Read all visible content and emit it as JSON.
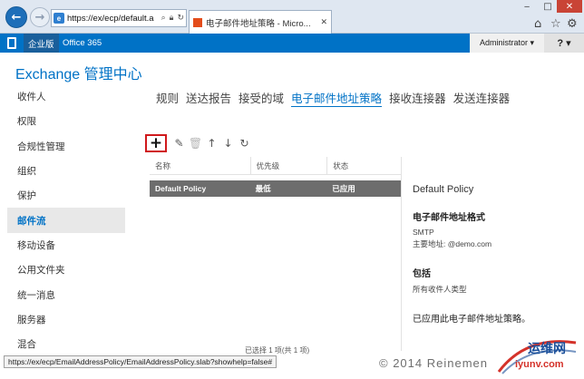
{
  "browser": {
    "address": "https://ex/ecp/default.a",
    "tab_title": "电子邮件地址策略 - Micro...",
    "tab_close": "✕",
    "window_controls": {
      "minimize": "‒",
      "maximize": "□",
      "close": "✕"
    },
    "toolbar_icons": [
      "home-icon",
      "star-icon",
      "gear-icon"
    ]
  },
  "suite_bar": {
    "enterprise": "企业版",
    "office365": "Office 365",
    "admin": "Administrator ▾",
    "help": "? ▾",
    "brand_color": "#0072c6"
  },
  "app": {
    "title": "Exchange 管理中心"
  },
  "left_nav": {
    "items": [
      {
        "label": "收件人"
      },
      {
        "label": "权限"
      },
      {
        "label": "合规性管理"
      },
      {
        "label": "组织"
      },
      {
        "label": "保护"
      },
      {
        "label": "邮件流"
      },
      {
        "label": "移动设备"
      },
      {
        "label": "公用文件夹"
      },
      {
        "label": "统一消息"
      },
      {
        "label": "服务器"
      },
      {
        "label": "混合"
      }
    ],
    "active_index": 5
  },
  "tabs": {
    "items": [
      "规则",
      "送达报告",
      "接受的域",
      "电子邮件地址策略",
      "接收连接器",
      "发送连接器"
    ],
    "active_index": 3
  },
  "list": {
    "columns": [
      "名称",
      "优先级",
      "状态"
    ],
    "rows": [
      {
        "name": "Default Policy",
        "priority": "最低",
        "status": "已应用"
      }
    ],
    "footer": "已选择 1 项(共 1 项)"
  },
  "details": {
    "title": "Default Policy",
    "format_heading": "电子邮件地址格式",
    "format_type": "SMTP",
    "primary_address": "主要地址: @demo.com",
    "includes_heading": "包括",
    "includes_value": "所有收件人类型",
    "applied_status": "已应用此电子邮件地址策略。"
  },
  "status_url": "https://ex/ecp/EmailAddressPolicy/EmailAddressPolicy.slab?showhelp=false#",
  "watermark": {
    "copyright": "© 2014 Reinemen",
    "site_cn": "运维网",
    "site_url": "iyunv.com"
  }
}
